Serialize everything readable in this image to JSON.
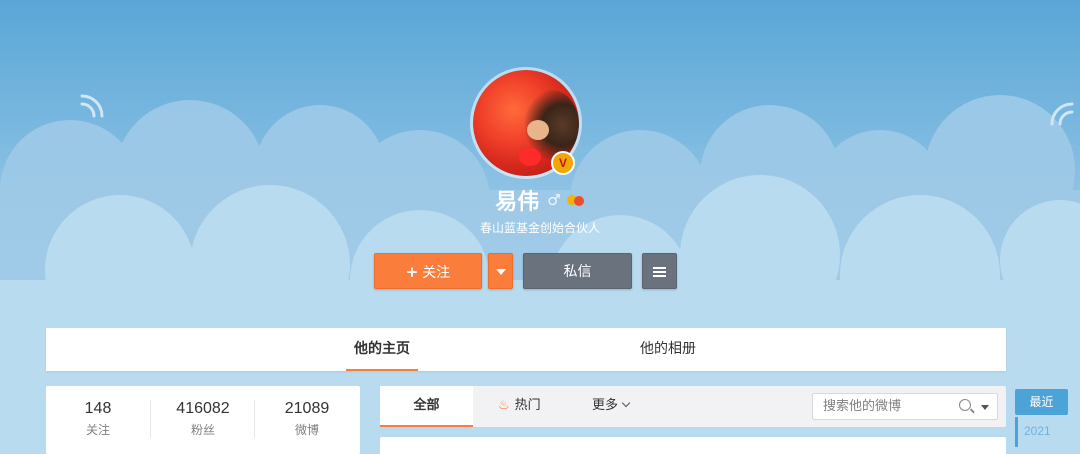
{
  "profile": {
    "name": "易伟",
    "gender_symbol": "♂",
    "description": "春山蓝基金创始合伙人",
    "verified_mark": "V"
  },
  "actions": {
    "follow_plus": "+",
    "follow_label": "关注",
    "message_label": "私信"
  },
  "tabs": [
    {
      "label": "他的主页",
      "active": true
    },
    {
      "label": "他的相册",
      "active": false
    }
  ],
  "stats": [
    {
      "value": "148",
      "label": "关注"
    },
    {
      "value": "416082",
      "label": "粉丝"
    },
    {
      "value": "21089",
      "label": "微博"
    }
  ],
  "feed_tabs": {
    "all": "全部",
    "hot": "热门",
    "more": "更多"
  },
  "search": {
    "placeholder": "搜索他的微博"
  },
  "timeline": {
    "active": "最近",
    "years": [
      "2021"
    ]
  },
  "colors": {
    "accent_orange": "#fa7d3c",
    "button_gray": "#6a727e",
    "timeline_blue": "#4ba3d8"
  }
}
